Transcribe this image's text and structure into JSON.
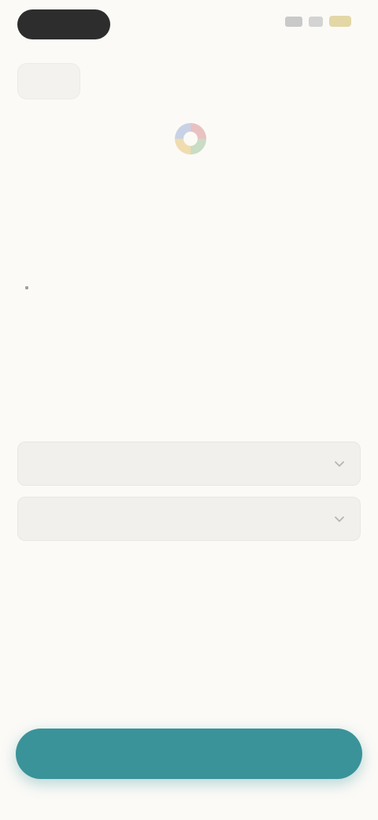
{
  "header": {
    "title": "",
    "subtitle": ""
  },
  "permissions": {
    "heading": "",
    "items": [
      "",
      "",
      "",
      "",
      ""
    ]
  },
  "selectors": [
    {
      "label": ""
    },
    {
      "label": ""
    }
  ],
  "footer_link": "",
  "primary_button": {
    "label": ""
  },
  "icons": {
    "logo": "four-color-logo-icon",
    "back": "back-icon",
    "chevron": "chevron-down-icon"
  },
  "colors": {
    "accent": "#3a9399",
    "background": "#fbfaf7",
    "surface": "#f1f0ec"
  }
}
